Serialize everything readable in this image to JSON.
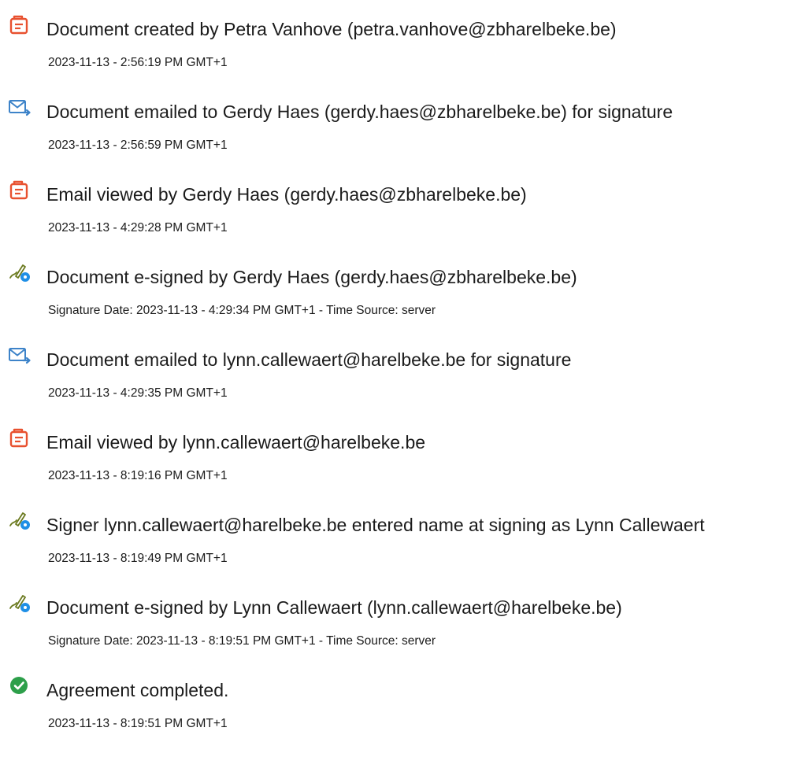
{
  "events": [
    {
      "icon": "document-created-icon",
      "title": "Document created by Petra Vanhove (petra.vanhove@zbharelbeke.be)",
      "time": "2023-11-13 - 2:56:19 PM GMT+1"
    },
    {
      "icon": "email-sent-icon",
      "title": "Document emailed to Gerdy Haes (gerdy.haes@zbharelbeke.be) for signature",
      "time": "2023-11-13 - 2:56:59 PM GMT+1"
    },
    {
      "icon": "document-viewed-icon",
      "title": "Email viewed by Gerdy Haes (gerdy.haes@zbharelbeke.be)",
      "time": "2023-11-13 - 4:29:28 PM GMT+1"
    },
    {
      "icon": "e-sign-icon",
      "title": "Document e-signed by Gerdy Haes (gerdy.haes@zbharelbeke.be)",
      "time": "Signature Date: 2023-11-13 - 4:29:34 PM GMT+1 - Time Source: server"
    },
    {
      "icon": "email-sent-icon",
      "title": "Document emailed to lynn.callewaert@harelbeke.be for signature",
      "time": "2023-11-13 - 4:29:35 PM GMT+1"
    },
    {
      "icon": "document-viewed-icon",
      "title": "Email viewed by lynn.callewaert@harelbeke.be",
      "time": "2023-11-13 - 8:19:16 PM GMT+1"
    },
    {
      "icon": "e-sign-icon",
      "title": "Signer lynn.callewaert@harelbeke.be entered name at signing as Lynn Callewaert",
      "time": "2023-11-13 - 8:19:49 PM GMT+1"
    },
    {
      "icon": "e-sign-icon",
      "title": "Document e-signed by Lynn Callewaert (lynn.callewaert@harelbeke.be)",
      "time": "Signature Date: 2023-11-13 - 8:19:51 PM GMT+1 - Time Source: server"
    },
    {
      "icon": "checkmark-circle-icon",
      "title": "Agreement completed.",
      "time": "2023-11-13 - 8:19:51 PM GMT+1"
    }
  ],
  "colors": {
    "document_icon": "#e8512f",
    "email_icon": "#3d83c9",
    "sign_icon_pen": "#6b7a1f",
    "sign_icon_badge": "#1f8fe6",
    "check_icon": "#2d9f4a"
  }
}
